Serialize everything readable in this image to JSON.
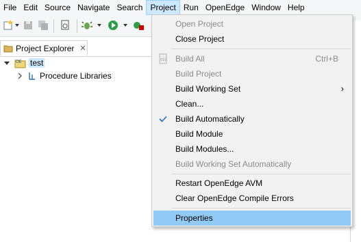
{
  "menubar": {
    "items": [
      "File",
      "Edit",
      "Source",
      "Navigate",
      "Search",
      "Project",
      "Run",
      "OpenEdge",
      "Window",
      "Help"
    ],
    "active_index": 5
  },
  "explorer": {
    "tab_label": "Project Explorer",
    "close_glyph": "✕",
    "tree": [
      {
        "label": "test",
        "expanded": true,
        "selected": true,
        "icon": "project-icon"
      },
      {
        "label": "Procedure Libraries",
        "expanded": false,
        "selected": false,
        "icon": "library-icon"
      }
    ]
  },
  "project_menu": {
    "items": [
      {
        "label": "Open Project",
        "enabled": false
      },
      {
        "label": "Close Project",
        "enabled": true
      },
      {
        "separator": true
      },
      {
        "label": "Build All",
        "enabled": false,
        "shortcut": "Ctrl+B",
        "icon": "build-all-icon"
      },
      {
        "label": "Build Project",
        "enabled": false
      },
      {
        "label": "Build Working Set",
        "enabled": true,
        "submenu": true
      },
      {
        "label": "Clean...",
        "enabled": true
      },
      {
        "label": "Build Automatically",
        "enabled": true,
        "checked": true
      },
      {
        "label": "Build Module",
        "enabled": true
      },
      {
        "label": "Build Modules...",
        "enabled": true
      },
      {
        "label": "Build Working Set Automatically",
        "enabled": false
      },
      {
        "separator": true
      },
      {
        "label": "Restart OpenEdge AVM",
        "enabled": true
      },
      {
        "label": "Clear OpenEdge Compile Errors",
        "enabled": true
      },
      {
        "separator": true
      },
      {
        "label": "Properties",
        "enabled": true,
        "highlighted": true
      }
    ]
  },
  "colors": {
    "menu_highlight": "#91c9f7",
    "menubar_active": "#cce8ff",
    "disabled_text": "#8a8a8a",
    "check_color": "#1f6fc5"
  }
}
